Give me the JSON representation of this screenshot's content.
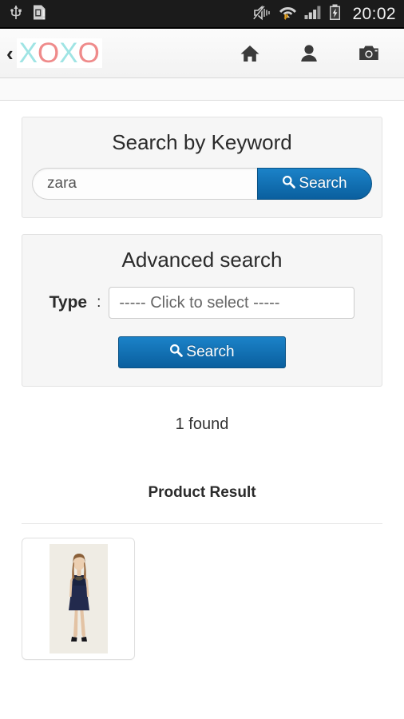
{
  "statusbar": {
    "time": "20:02",
    "icons_left": [
      "usb-icon",
      "sim-card-alert-icon"
    ],
    "icons_right": [
      "mute-icon",
      "wifi-data-icon",
      "cellular-signal-icon",
      "battery-charging-icon"
    ]
  },
  "appbar": {
    "back_label": "‹",
    "logo": [
      {
        "char": "X",
        "style": "x"
      },
      {
        "char": "O",
        "style": "o"
      },
      {
        "char": "X",
        "style": "x"
      },
      {
        "char": "O",
        "style": "o"
      }
    ],
    "actions": [
      {
        "name": "home-icon"
      },
      {
        "name": "profile-icon"
      },
      {
        "name": "camera-icon"
      }
    ]
  },
  "keyword_panel": {
    "title": "Search by Keyword",
    "input_value": "zara",
    "input_placeholder": "zara",
    "search_label": "Search"
  },
  "advanced_panel": {
    "title": "Advanced search",
    "type_label": "Type",
    "colon": ":",
    "select_value": "----- Click to select -----",
    "search_label": "Search"
  },
  "results": {
    "found_text": "1 found",
    "section_title": "Product Result",
    "items": [
      {
        "alt": "navy sleeveless dress on model"
      }
    ]
  },
  "colors": {
    "accent_blue": "#0a5f9e",
    "accent_blue_light": "#1b82c8",
    "logo_x": "#9fe4e4",
    "logo_o": "#ef8b8b",
    "panel_bg": "#f6f6f6",
    "statusbar_bg": "#1b1b1b"
  }
}
